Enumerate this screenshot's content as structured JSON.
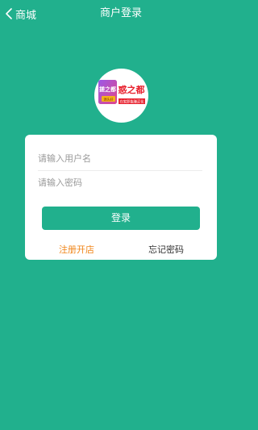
{
  "nav": {
    "back_label": "商城",
    "title": "商户登录"
  },
  "logo": {
    "left_text": "搓之都",
    "left_sub": "源头好",
    "right_title": "惑之都",
    "right_sub": "在家即能赚买化"
  },
  "form": {
    "username_placeholder": "请输入用户名",
    "password_placeholder": "请输入密码",
    "login_label": "登录",
    "register_label": "注册开店",
    "forgot_label": "忘记密码"
  },
  "colors": {
    "brand": "#21b08d",
    "register_link": "#f08519"
  }
}
